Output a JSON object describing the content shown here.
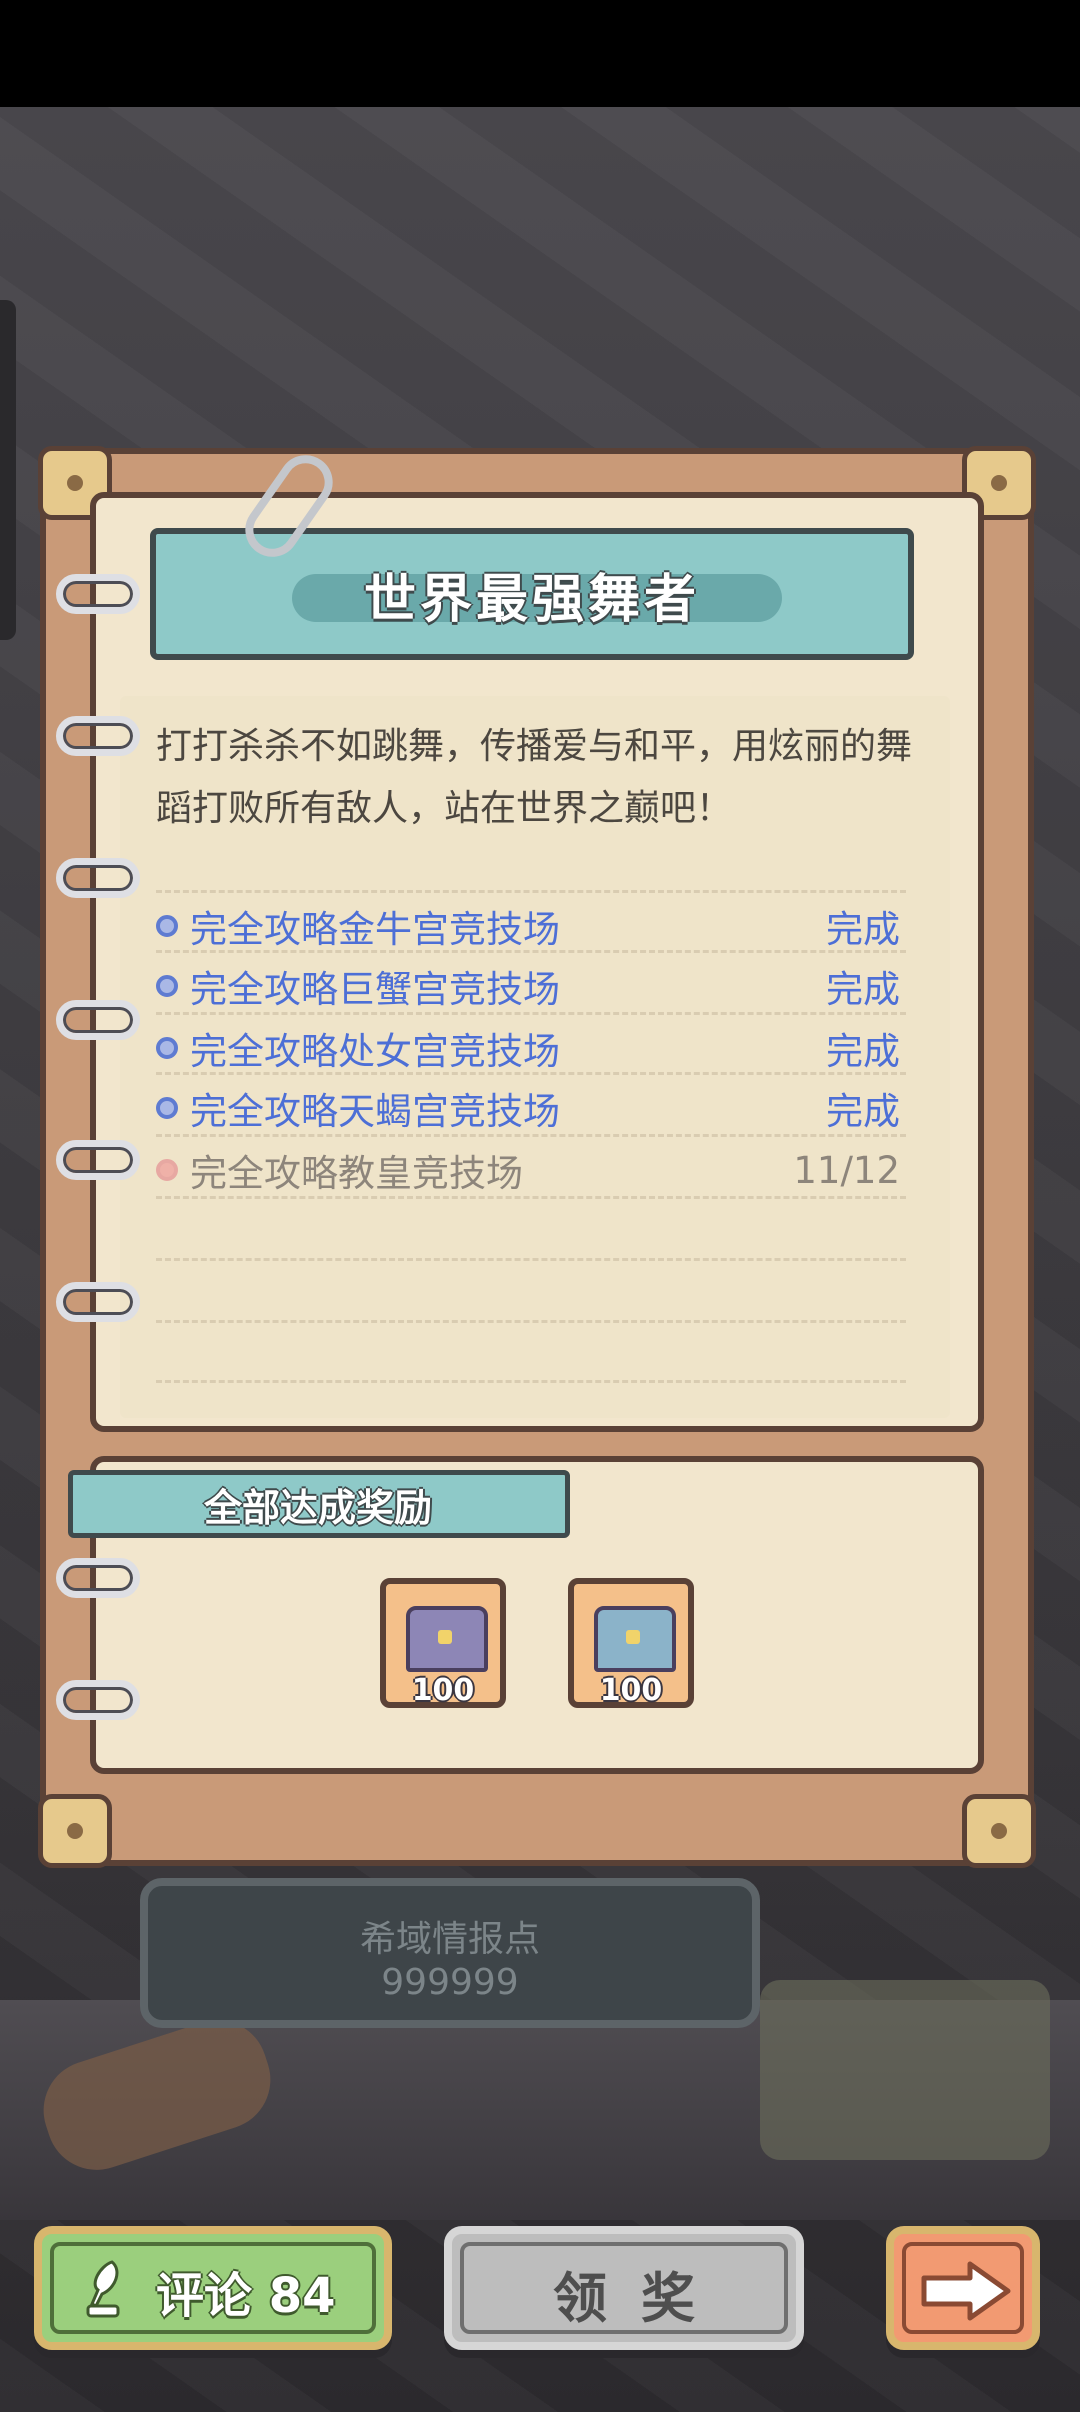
{
  "quest": {
    "title": "世界最强舞者",
    "description": "打打杀杀不如跳舞，传播爱与和平，用炫丽的舞蹈打败所有敌人，站在世界之巅吧！",
    "tasks": [
      {
        "label": "完全攻略金牛宫竞技场",
        "status": "完成",
        "state": "done"
      },
      {
        "label": "完全攻略巨蟹宫竞技场",
        "status": "完成",
        "state": "done"
      },
      {
        "label": "完全攻略处女宫竞技场",
        "status": "完成",
        "state": "done"
      },
      {
        "label": "完全攻略天蝎宫竞技场",
        "status": "完成",
        "state": "done"
      },
      {
        "label": "完全攻略教皇竞技场",
        "status": "11/12",
        "state": "pending"
      }
    ]
  },
  "rewards": {
    "title": "全部达成奖励",
    "items": [
      {
        "icon": "silver-chest-icon",
        "count": "100"
      },
      {
        "icon": "gold-chest-icon",
        "count": "100"
      }
    ]
  },
  "intel": {
    "label": "希域情报点",
    "value": "999999"
  },
  "buttons": {
    "comment_label": "评论 84",
    "claim_label": "领奖",
    "next_icon": "arrow-right-icon"
  },
  "colors": {
    "done": "#4d6fd6",
    "pending": "#8d857b",
    "banner": "#8ec9c8",
    "comment_button": "#9bcf7d",
    "claim_button_disabled": "#bdbdbd",
    "next_button": "#f29a72"
  }
}
